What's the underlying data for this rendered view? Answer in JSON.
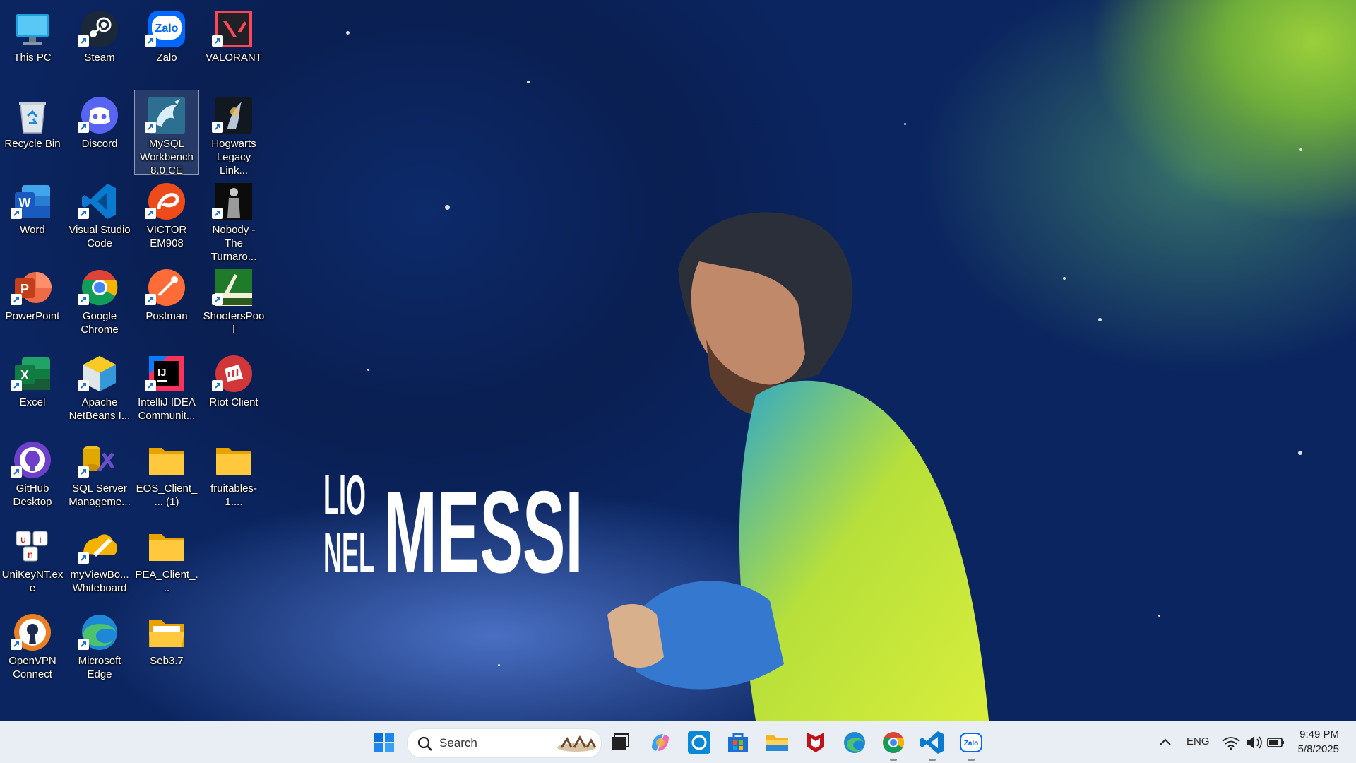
{
  "desktop": {
    "icons": [
      {
        "id": "this-pc",
        "label": "This PC",
        "icon": "monitor-icon"
      },
      {
        "id": "steam",
        "label": "Steam",
        "icon": "steam-icon"
      },
      {
        "id": "zalo",
        "label": "Zalo",
        "icon": "zalo-icon"
      },
      {
        "id": "valorant",
        "label": "VALORANT",
        "icon": "valorant-icon"
      },
      {
        "id": "recycle-bin",
        "label": "Recycle Bin",
        "icon": "recycle-bin-icon"
      },
      {
        "id": "discord",
        "label": "Discord",
        "icon": "discord-icon"
      },
      {
        "id": "mysql-workbench",
        "label": "MySQL Workbench 8.0 CE",
        "icon": "mysql-dolphin-icon"
      },
      {
        "id": "hogwarts",
        "label": "Hogwarts Legacy Link...",
        "icon": "hogwarts-icon"
      },
      {
        "id": "word",
        "label": "Word",
        "icon": "word-icon"
      },
      {
        "id": "vscode",
        "label": "Visual Studio Code",
        "icon": "vscode-icon"
      },
      {
        "id": "victor",
        "label": "VICTOR EM908",
        "icon": "victor-icon"
      },
      {
        "id": "nobody",
        "label": "Nobody - The Turnaro...",
        "icon": "nobody-game-icon"
      },
      {
        "id": "powerpoint",
        "label": "PowerPoint",
        "icon": "powerpoint-icon"
      },
      {
        "id": "chrome",
        "label": "Google Chrome",
        "icon": "chrome-icon"
      },
      {
        "id": "postman",
        "label": "Postman",
        "icon": "postman-icon"
      },
      {
        "id": "shooterspool",
        "label": "ShootersPool",
        "icon": "shooterspool-icon"
      },
      {
        "id": "excel",
        "label": "Excel",
        "icon": "excel-icon"
      },
      {
        "id": "netbeans",
        "label": "Apache NetBeans I...",
        "icon": "netbeans-icon"
      },
      {
        "id": "intellij",
        "label": "IntelliJ IDEA Communit...",
        "icon": "intellij-icon"
      },
      {
        "id": "riot",
        "label": "Riot Client",
        "icon": "riot-icon"
      },
      {
        "id": "github",
        "label": "GitHub Desktop",
        "icon": "github-icon"
      },
      {
        "id": "ssms",
        "label": "SQL Server Manageme...",
        "icon": "sql-server-icon"
      },
      {
        "id": "eos-client",
        "label": "EOS_Client_... (1)",
        "icon": "folder-icon"
      },
      {
        "id": "fruitables",
        "label": "fruitables-1....",
        "icon": "folder-icon"
      },
      {
        "id": "unikey",
        "label": "UniKeyNT.exe",
        "icon": "unikey-icon"
      },
      {
        "id": "myviewboard",
        "label": "myViewBo... Whiteboard",
        "icon": "myviewboard-icon"
      },
      {
        "id": "pea-client",
        "label": "PEA_Client_...",
        "icon": "folder-icon"
      },
      {
        "id": "openvpn",
        "label": "OpenVPN Connect",
        "icon": "openvpn-icon"
      },
      {
        "id": "edge",
        "label": "Microsoft Edge",
        "icon": "edge-icon"
      },
      {
        "id": "seb",
        "label": "Seb3.7",
        "icon": "folder-open-icon"
      }
    ],
    "wallpaper_text": {
      "line1": "LIO",
      "line2": "NEL",
      "big": "MESSI"
    }
  },
  "taskbar": {
    "search_label": "Search",
    "apps": [
      "start-icon",
      "search-icon",
      "task-view-icon",
      "copilot-icon",
      "cortana-icon",
      "microsoft-store-icon",
      "file-explorer-icon",
      "mcafee-icon",
      "edge-icon",
      "chrome-icon",
      "vscode-icon",
      "zalo-icon"
    ],
    "tray": {
      "language": "ENG",
      "time": "9:49 PM",
      "date": "5/8/2025"
    }
  },
  "colors": {
    "taskbar_bg": "#e9eef5",
    "accent": "#0078d4"
  }
}
